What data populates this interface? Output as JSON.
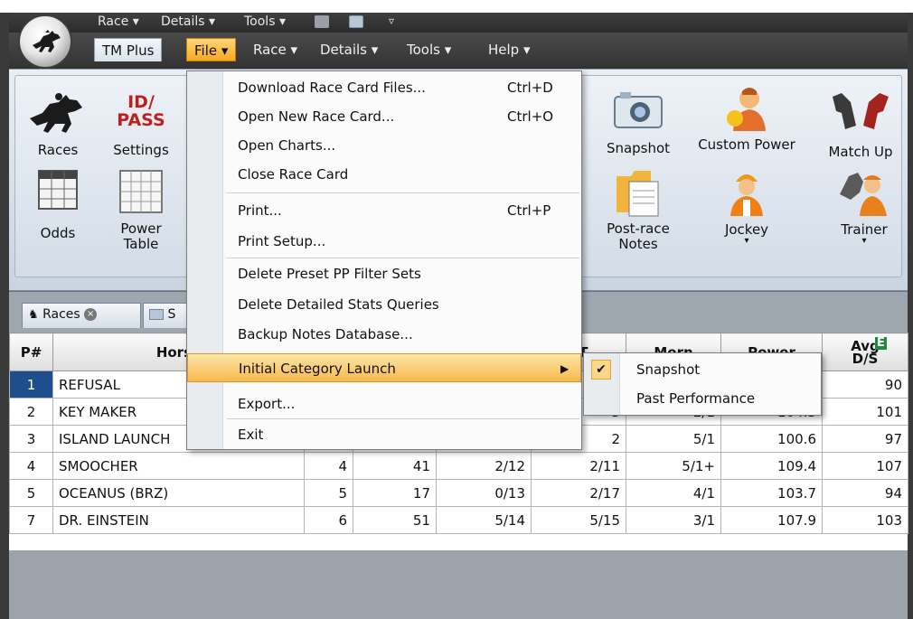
{
  "qat": {
    "race": "Race",
    "details": "Details",
    "tools": "Tools"
  },
  "menu_tabs": {
    "tm_plus": "TM Plus",
    "file": "File",
    "race": "Race",
    "details": "Details",
    "tools": "Tools",
    "help": "Help"
  },
  "ribbon": {
    "races": "Races",
    "settings": "Settings",
    "id_pass": "ID/\nPASS",
    "odds": "Odds",
    "power_table": "Power\nTable",
    "snapshot": "Snapshot",
    "custom_power": "Custom Power",
    "match_up": "Match Up",
    "post_race_notes": "Post-race\nNotes",
    "jockey": "Jockey",
    "trainer": "Trainer"
  },
  "doc_tabs": {
    "races": "Races",
    "second_fragment": "S"
  },
  "file_menu": {
    "items": [
      {
        "label": "Download Race Card Files...",
        "shortcut": "Ctrl+D"
      },
      {
        "label": "Open New Race Card...",
        "shortcut": "Ctrl+O"
      },
      {
        "label": "Open Charts...",
        "shortcut": ""
      },
      {
        "label": "Close Race Card",
        "shortcut": ""
      },
      {
        "label": "Print...",
        "shortcut": "Ctrl+P"
      },
      {
        "label": "Print Setup...",
        "shortcut": ""
      },
      {
        "label": "Delete Preset PP Filter Sets",
        "shortcut": ""
      },
      {
        "label": "Delete Detailed Stats Queries",
        "shortcut": ""
      },
      {
        "label": "Backup Notes Database...",
        "shortcut": ""
      },
      {
        "label": "Initial Category Launch",
        "shortcut": ""
      },
      {
        "label": "Export...",
        "shortcut": ""
      },
      {
        "label": "Exit",
        "shortcut": ""
      }
    ]
  },
  "submenu": {
    "items": [
      {
        "label": "Snapshot",
        "checked": true
      },
      {
        "label": "Past Performance",
        "checked": false
      }
    ]
  },
  "grid": {
    "headers": {
      "pnum": "P#",
      "horse": "Horse",
      "st": "ST",
      "morn": "Morn",
      "power": "Power",
      "avg_ds": "Avg\nD/S",
      "avg_badge": "E"
    },
    "rows": [
      {
        "p": "1",
        "horse": "REFUSAL",
        "c3": "",
        "c4": "",
        "c5": "",
        "c6": "",
        "morn": "",
        "power": "",
        "avg": "90",
        "selected": true
      },
      {
        "p": "2",
        "horse": "KEY MAKER",
        "c3": "",
        "c4": "",
        "c5": "",
        "c6": "3",
        "morn": "2/1",
        "power": "104.3",
        "avg": "101",
        "selected": false
      },
      {
        "p": "3",
        "horse": "ISLAND LAUNCH",
        "c3": "",
        "c4": "",
        "c5": "",
        "c6": "2",
        "morn": "5/1",
        "power": "100.6",
        "avg": "97",
        "selected": false
      },
      {
        "p": "4",
        "horse": "SMOOCHER",
        "c3": "4",
        "c4": "41",
        "c5": "2/12",
        "c6": "2/11",
        "morn": "5/1+",
        "power": "109.4",
        "avg": "107",
        "selected": false
      },
      {
        "p": "5",
        "horse": "OCEANUS (BRZ)",
        "c3": "5",
        "c4": "17",
        "c5": "0/13",
        "c6": "2/17",
        "morn": "4/1",
        "power": "103.7",
        "avg": "94",
        "selected": false
      },
      {
        "p": "7",
        "horse": "DR. EINSTEIN",
        "c3": "6",
        "c4": "51",
        "c5": "5/14",
        "c6": "5/15",
        "morn": "3/1",
        "power": "107.9",
        "avg": "103",
        "selected": false
      }
    ]
  },
  "colors": {
    "menu_highlight": "#f7b94c",
    "selection": "#1f4e8f",
    "ribbon_bg": "#d3dce7"
  }
}
